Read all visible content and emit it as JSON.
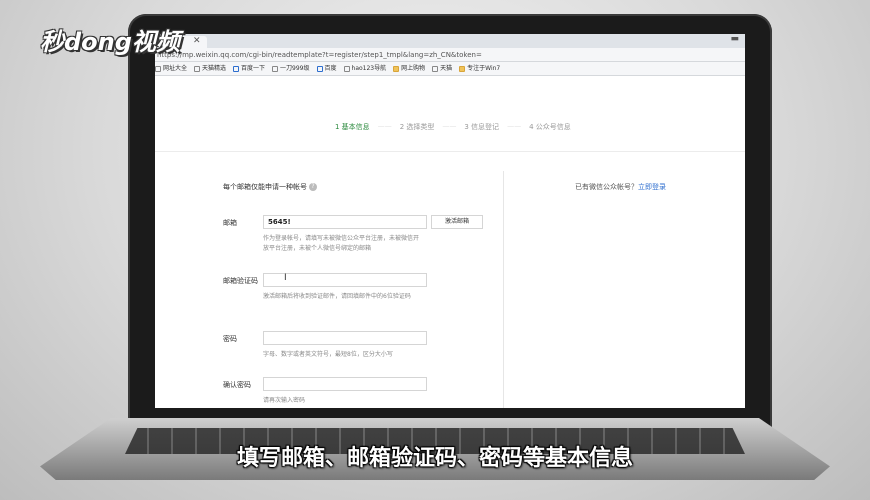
{
  "overlay": {
    "logo_text": "秒dong视频",
    "subtitle": "填写邮箱、邮箱验证码、密码等基本信息"
  },
  "browser": {
    "url": "https://mp.weixin.qq.com/cgi-bin/readtemplate?t=register/step1_tmpl&lang=zh_CN&token=",
    "tab_close": "✕",
    "bookmarks": [
      {
        "label": "网址大全",
        "icon": "page-icon"
      },
      {
        "label": "天猫精选",
        "icon": "page-icon"
      },
      {
        "label": "百度一下",
        "icon": "home-icon"
      },
      {
        "label": "一刀999级",
        "icon": "page-icon"
      },
      {
        "label": "百度",
        "icon": "home-icon"
      },
      {
        "label": "hao123导航",
        "icon": "page-icon"
      },
      {
        "label": "网上购物",
        "icon": "folder-icon"
      },
      {
        "label": "天猫",
        "icon": "page-icon"
      },
      {
        "label": "专注于Win7",
        "icon": "folder-icon"
      }
    ]
  },
  "steps": [
    {
      "label": "1 基本信息",
      "active": true
    },
    {
      "label": "2 选择类型",
      "active": false
    },
    {
      "label": "3 信息登记",
      "active": false
    },
    {
      "label": "4 公众号信息",
      "active": false
    }
  ],
  "steps_separator": "——",
  "form": {
    "notice": "每个邮箱仅能申请一种帐号",
    "help_icon": "?",
    "email": {
      "label": "邮箱",
      "value": "5645!",
      "button": "激活邮箱",
      "hint": "作为登录帐号，请填写未被微信公众平台注册，未被微信开放平台注册，未被个人微信号绑定的邮箱"
    },
    "code": {
      "label": "邮箱验证码",
      "value": "",
      "hint": "激活邮箱后将收到验证邮件，请回填邮件中的6位验证码"
    },
    "password": {
      "label": "密码",
      "value": "",
      "hint": "字母、数字或者英文符号，最短8位，区分大小写"
    },
    "confirm": {
      "label": "确认密码",
      "value": "",
      "hint": "请再次输入密码"
    }
  },
  "right": {
    "question": "已有微信公众帐号？",
    "login_link": "立即登录"
  },
  "cursor_glyph": "I"
}
